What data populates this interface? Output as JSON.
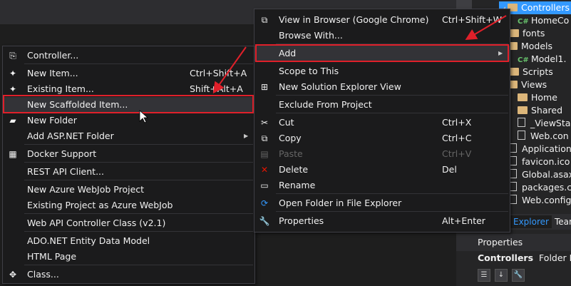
{
  "solution_explorer": {
    "tree": [
      {
        "label": "Controllers",
        "icon": "folder-icon",
        "selected": true,
        "expander": "◢"
      },
      {
        "label": "HomeCo",
        "icon": "csharp-file-icon"
      },
      {
        "label": "fonts",
        "icon": "folder-icon"
      },
      {
        "label": "Models",
        "icon": "folder-icon",
        "expander": "◢"
      },
      {
        "label": "Model1.",
        "icon": "csharp-file-icon"
      },
      {
        "label": "Scripts",
        "icon": "folder-icon"
      },
      {
        "label": "Views",
        "icon": "folder-icon",
        "expander": "◢"
      },
      {
        "label": "Home",
        "icon": "folder-icon"
      },
      {
        "label": "Shared",
        "icon": "folder-icon"
      },
      {
        "label": "_ViewSta",
        "icon": "razor-file-icon"
      },
      {
        "label": "Web.con",
        "icon": "config-file-icon"
      },
      {
        "label": "Applicationl",
        "icon": "file-icon"
      },
      {
        "label": "favicon.ico",
        "icon": "file-icon"
      },
      {
        "label": "Global.asax",
        "icon": "file-icon"
      },
      {
        "label": "packages.co",
        "icon": "file-icon"
      },
      {
        "label": "Web.config",
        "icon": "file-icon"
      }
    ],
    "tabs": [
      "Explorer",
      "Tear"
    ],
    "properties_title": "Properties",
    "properties_object": "Controllers",
    "properties_kind": "Folder Pro"
  },
  "left_menu": {
    "items": [
      {
        "label": "Controller...",
        "icon": "controller-icon",
        "icon_glyph": "⎘"
      },
      {
        "label": "New Item...",
        "shortcut": "Ctrl+Shift+A",
        "icon": "new-item-icon",
        "icon_glyph": "✦"
      },
      {
        "label": "Existing Item...",
        "shortcut": "Shift+Alt+A",
        "icon": "existing-item-icon",
        "icon_glyph": "✦"
      },
      {
        "label": "New Scaffolded Item...",
        "highlighted": true
      },
      {
        "label": "New Folder",
        "icon": "new-folder-icon",
        "icon_glyph": "▰"
      },
      {
        "label": "Add ASP.NET Folder",
        "submenu": true
      },
      {
        "label": "Docker Support",
        "icon": "docker-icon",
        "icon_glyph": "▦"
      },
      {
        "label": "REST API Client..."
      },
      {
        "label": "New Azure WebJob Project"
      },
      {
        "label": "Existing Project as Azure WebJob"
      },
      {
        "label": "Web API Controller Class (v2.1)"
      },
      {
        "label": "ADO.NET Entity Data Model"
      },
      {
        "label": "HTML Page"
      },
      {
        "label": "Class...",
        "icon": "class-icon",
        "icon_glyph": "✥"
      }
    ]
  },
  "right_menu": {
    "items": [
      {
        "label": "View in Browser (Google Chrome)",
        "shortcut": "Ctrl+Shift+W",
        "icon": "browser-icon",
        "icon_glyph": "⧉"
      },
      {
        "label": "Browse With..."
      },
      {
        "label": "Add",
        "submenu": true,
        "highlighted": true
      },
      {
        "label": "Scope to This"
      },
      {
        "label": "New Solution Explorer View",
        "icon": "solution-explorer-icon",
        "icon_glyph": "⊞"
      },
      {
        "label": "Exclude From Project"
      },
      {
        "label": "Cut",
        "shortcut": "Ctrl+X",
        "icon": "cut-icon",
        "icon_glyph": "✂"
      },
      {
        "label": "Copy",
        "shortcut": "Ctrl+C",
        "icon": "copy-icon",
        "icon_glyph": "⧉"
      },
      {
        "label": "Paste",
        "shortcut": "Ctrl+V",
        "disabled": true,
        "icon": "paste-icon",
        "icon_glyph": "▤"
      },
      {
        "label": "Delete",
        "shortcut": "Del",
        "icon": "delete-icon",
        "icon_glyph": "✕",
        "icon_color": "#e51400"
      },
      {
        "label": "Rename",
        "icon": "rename-icon",
        "icon_glyph": "▭"
      },
      {
        "label": "Open Folder in File Explorer",
        "icon": "refresh-icon",
        "icon_glyph": "⟳",
        "icon_color": "#3399ff"
      },
      {
        "label": "Properties",
        "shortcut": "Alt+Enter",
        "icon": "wrench-icon",
        "icon_glyph": "🔧"
      }
    ]
  },
  "colors": {
    "menu_bg": "#1b1b1c",
    "highlight_border": "#e0202a",
    "selection": "#3399ff",
    "annotation_arrow": "#e0202a"
  }
}
